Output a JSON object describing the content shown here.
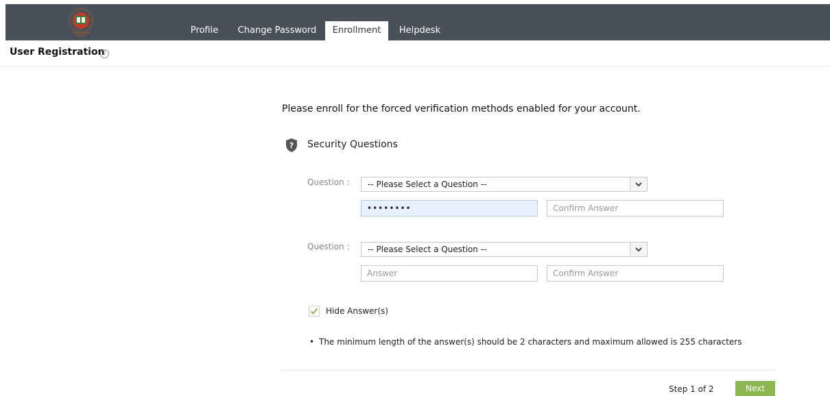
{
  "nav": {
    "tabs": [
      {
        "label": "Profile"
      },
      {
        "label": "Change Password"
      },
      {
        "label": "Enrollment"
      },
      {
        "label": "Helpdesk"
      }
    ],
    "active_tab": "Enrollment"
  },
  "header": {
    "title": "User Registration",
    "help_glyph": "?"
  },
  "main": {
    "intro": "Please enroll for the forced verification methods enabled for your account.",
    "section_title": "Security Questions",
    "section_icon": "shield-question-icon",
    "questions": [
      {
        "label": "Question :",
        "selected": "-- Please Select a Question --",
        "answer_value": "••••••••",
        "answer_placeholder": "Answer",
        "confirm_placeholder": "Confirm Answer"
      },
      {
        "label": "Question :",
        "selected": "-- Please Select a Question --",
        "answer_value": "",
        "answer_placeholder": "Answer",
        "confirm_placeholder": "Confirm Answer"
      }
    ],
    "hide_answers": {
      "label": "Hide Answer(s)",
      "checked": true
    },
    "note_bullet": "•",
    "note": "The minimum length of the answer(s) should be 2 characters and maximum allowed is 255 characters"
  },
  "footer": {
    "step": "Step 1 of 2",
    "next_label": "Next"
  },
  "colors": {
    "topbar": "#4a5059",
    "accent_green": "#8ab74f",
    "autofill_blue": "#e8f0fe"
  }
}
